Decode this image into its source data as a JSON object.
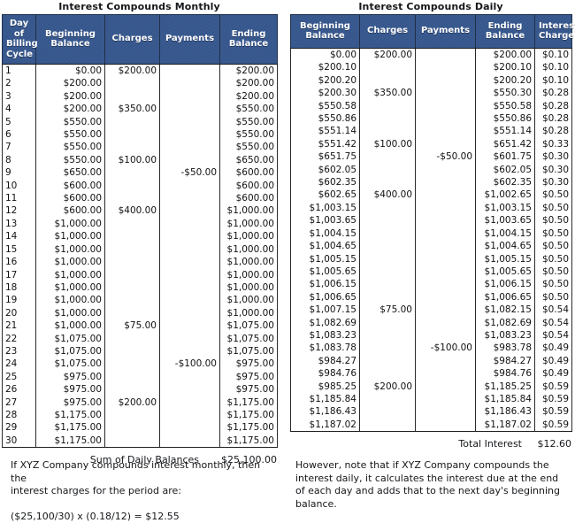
{
  "document": {
    "kind": "interest-calculation-comparison-tables"
  },
  "colors": {
    "header_blue": "#35568c",
    "header_text": "#ffffff",
    "grid_line": "#2a2a2a",
    "body_text": "#111111"
  },
  "monthly": {
    "title": "Interest Compounds Monthly",
    "columns": [
      "Day of Billing Cycle",
      "Beginning Balance",
      "Charges",
      "Payments",
      "Ending Balance"
    ],
    "column_labels_multiline": [
      [
        "Day of",
        "Billing",
        "Cycle"
      ],
      [
        "Beginning",
        "Balance"
      ],
      [
        "Charges"
      ],
      [
        "Payments"
      ],
      [
        "Ending",
        "Balance"
      ]
    ],
    "rows": [
      [
        "1",
        "$0.00",
        "$200.00",
        "",
        "$200.00"
      ],
      [
        "2",
        "$200.00",
        "",
        "",
        "$200.00"
      ],
      [
        "3",
        "$200.00",
        "",
        "",
        "$200.00"
      ],
      [
        "4",
        "$200.00",
        "$350.00",
        "",
        "$550.00"
      ],
      [
        "5",
        "$550.00",
        "",
        "",
        "$550.00"
      ],
      [
        "6",
        "$550.00",
        "",
        "",
        "$550.00"
      ],
      [
        "7",
        "$550.00",
        "",
        "",
        "$550.00"
      ],
      [
        "8",
        "$550.00",
        "$100.00",
        "",
        "$650.00"
      ],
      [
        "9",
        "$650.00",
        "",
        "-$50.00",
        "$600.00"
      ],
      [
        "10",
        "$600.00",
        "",
        "",
        "$600.00"
      ],
      [
        "11",
        "$600.00",
        "",
        "",
        "$600.00"
      ],
      [
        "12",
        "$600.00",
        "$400.00",
        "",
        "$1,000.00"
      ],
      [
        "13",
        "$1,000.00",
        "",
        "",
        "$1,000.00"
      ],
      [
        "14",
        "$1,000.00",
        "",
        "",
        "$1,000.00"
      ],
      [
        "15",
        "$1,000.00",
        "",
        "",
        "$1,000.00"
      ],
      [
        "16",
        "$1,000.00",
        "",
        "",
        "$1,000.00"
      ],
      [
        "17",
        "$1,000.00",
        "",
        "",
        "$1,000.00"
      ],
      [
        "18",
        "$1,000.00",
        "",
        "",
        "$1,000.00"
      ],
      [
        "19",
        "$1,000.00",
        "",
        "",
        "$1,000.00"
      ],
      [
        "20",
        "$1,000.00",
        "",
        "",
        "$1,000.00"
      ],
      [
        "21",
        "$1,000.00",
        "$75.00",
        "",
        "$1,075.00"
      ],
      [
        "22",
        "$1,075.00",
        "",
        "",
        "$1,075.00"
      ],
      [
        "23",
        "$1,075.00",
        "",
        "",
        "$1,075.00"
      ],
      [
        "24",
        "$1,075.00",
        "",
        "-$100.00",
        "$975.00"
      ],
      [
        "25",
        "$975.00",
        "",
        "",
        "$975.00"
      ],
      [
        "26",
        "$975.00",
        "",
        "",
        "$975.00"
      ],
      [
        "27",
        "$975.00",
        "$200.00",
        "",
        "$1,175.00"
      ],
      [
        "28",
        "$1,175.00",
        "",
        "",
        "$1,175.00"
      ],
      [
        "29",
        "$1,175.00",
        "",
        "",
        "$1,175.00"
      ],
      [
        "30",
        "$1,175.00",
        "",
        "",
        "$1,175.00"
      ]
    ],
    "total_label": "Sum of Daily Balances",
    "total_value": "$25,100.00",
    "note_line_1": "If XYZ Company compounds interest monthly, then the",
    "note_line_2": "interest charges for the period are:",
    "note_formula": "($25,100/30) x (0.18/12) = $12.55"
  },
  "daily": {
    "title": "Interest Compounds Daily",
    "columns": [
      "Beginning Balance",
      "Charges",
      "Payments",
      "Ending Balance",
      "Interest Charge"
    ],
    "column_labels_multiline": [
      [
        "Beginning",
        "Balance"
      ],
      [
        "Charges"
      ],
      [
        "Payments"
      ],
      [
        "Ending",
        "Balance"
      ],
      [
        "Interest",
        "Charge"
      ]
    ],
    "rows": [
      [
        "$0.00",
        "$200.00",
        "",
        "$200.00",
        "$0.10"
      ],
      [
        "$200.10",
        "",
        "",
        "$200.10",
        "$0.10"
      ],
      [
        "$200.20",
        "",
        "",
        "$200.20",
        "$0.10"
      ],
      [
        "$200.30",
        "$350.00",
        "",
        "$550.30",
        "$0.28"
      ],
      [
        "$550.58",
        "",
        "",
        "$550.58",
        "$0.28"
      ],
      [
        "$550.86",
        "",
        "",
        "$550.86",
        "$0.28"
      ],
      [
        "$551.14",
        "",
        "",
        "$551.14",
        "$0.28"
      ],
      [
        "$551.42",
        "$100.00",
        "",
        "$651.42",
        "$0.33"
      ],
      [
        "$651.75",
        "",
        "-$50.00",
        "$601.75",
        "$0.30"
      ],
      [
        "$602.05",
        "",
        "",
        "$602.05",
        "$0.30"
      ],
      [
        "$602.35",
        "",
        "",
        "$602.35",
        "$0.30"
      ],
      [
        "$602.65",
        "$400.00",
        "",
        "$1,002.65",
        "$0.50"
      ],
      [
        "$1,003.15",
        "",
        "",
        "$1,003.15",
        "$0.50"
      ],
      [
        "$1,003.65",
        "",
        "",
        "$1,003.65",
        "$0.50"
      ],
      [
        "$1,004.15",
        "",
        "",
        "$1,004.15",
        "$0.50"
      ],
      [
        "$1,004.65",
        "",
        "",
        "$1,004.65",
        "$0.50"
      ],
      [
        "$1,005.15",
        "",
        "",
        "$1,005.15",
        "$0.50"
      ],
      [
        "$1,005.65",
        "",
        "",
        "$1,005.65",
        "$0.50"
      ],
      [
        "$1,006.15",
        "",
        "",
        "$1,006.15",
        "$0.50"
      ],
      [
        "$1,006.65",
        "",
        "",
        "$1,006.65",
        "$0.50"
      ],
      [
        "$1,007.15",
        "$75.00",
        "",
        "$1,082.15",
        "$0.54"
      ],
      [
        "$1,082.69",
        "",
        "",
        "$1,082.69",
        "$0.54"
      ],
      [
        "$1,083.23",
        "",
        "",
        "$1,083.23",
        "$0.54"
      ],
      [
        "$1,083.78",
        "",
        "-$100.00",
        "$983.78",
        "$0.49"
      ],
      [
        "$984.27",
        "",
        "",
        "$984.27",
        "$0.49"
      ],
      [
        "$984.76",
        "",
        "",
        "$984.76",
        "$0.49"
      ],
      [
        "$985.25",
        "$200.00",
        "",
        "$1,185.25",
        "$0.59"
      ],
      [
        "$1,185.84",
        "",
        "",
        "$1,185.84",
        "$0.59"
      ],
      [
        "$1,186.43",
        "",
        "",
        "$1,186.43",
        "$0.59"
      ],
      [
        "$1,187.02",
        "",
        "",
        "$1,187.02",
        "$0.59"
      ]
    ],
    "total_label": "Total Interest",
    "total_value": "$12.60",
    "note_line_1": "However, note that if XYZ Company compounds the",
    "note_line_2": "interest daily, it calculates the interest due at the end",
    "note_line_3": "of each day and adds that to the next day's beginning",
    "note_line_4": "balance."
  }
}
